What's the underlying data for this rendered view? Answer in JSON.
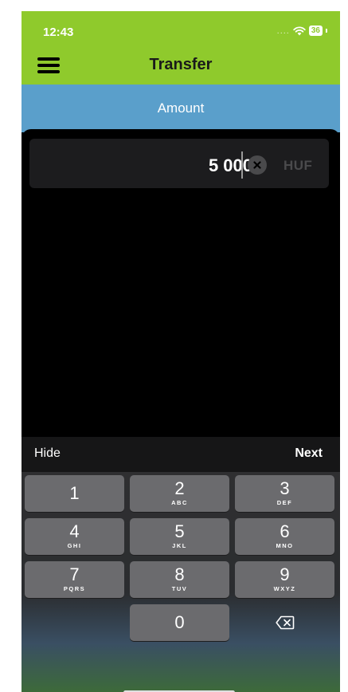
{
  "status_bar": {
    "time": "12:43",
    "signal": "....",
    "battery": "36"
  },
  "header": {
    "title": "Transfer",
    "menu_icon": "hamburger-menu-icon"
  },
  "section": {
    "label": "Amount"
  },
  "amount": {
    "value": "5 000",
    "currency": "HUF"
  },
  "keyboard_toolbar": {
    "hide_label": "Hide",
    "next_label": "Next"
  },
  "keypad": {
    "keys": [
      {
        "num": "1",
        "letters": ""
      },
      {
        "num": "2",
        "letters": "ABC"
      },
      {
        "num": "3",
        "letters": "DEF"
      },
      {
        "num": "4",
        "letters": "GHI"
      },
      {
        "num": "5",
        "letters": "JKL"
      },
      {
        "num": "6",
        "letters": "MNO"
      },
      {
        "num": "7",
        "letters": "PQRS"
      },
      {
        "num": "8",
        "letters": "TUV"
      },
      {
        "num": "9",
        "letters": "WXYZ"
      },
      {
        "num": "0",
        "letters": ""
      }
    ],
    "delete_icon": "backspace-icon"
  },
  "colors": {
    "header": "#8fca2c",
    "section": "#5a9fcb",
    "key": "#6b6b6e"
  }
}
